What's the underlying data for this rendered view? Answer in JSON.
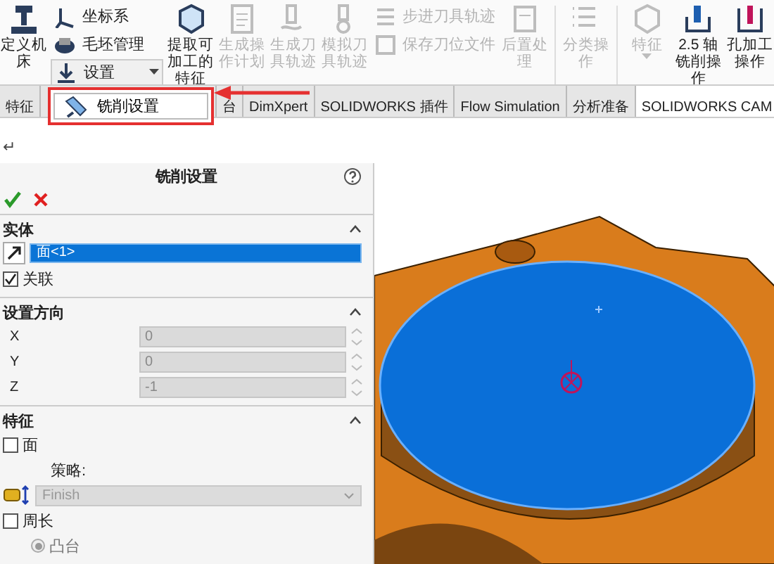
{
  "ribbon": {
    "columns": [
      {
        "kind": "large",
        "label": "定义机床",
        "disabled": false
      },
      {
        "kind": "stack",
        "items": [
          {
            "label": "坐标系",
            "disabled": false,
            "dropdown": false
          },
          {
            "label": "毛坯管理",
            "disabled": false,
            "dropdown": false
          },
          {
            "label": "设置",
            "disabled": false,
            "dropdown": true
          }
        ]
      },
      {
        "kind": "large",
        "label": "提取可加工的特征",
        "disabled": false
      },
      {
        "kind": "large",
        "label": "生成操作计划",
        "disabled": true
      },
      {
        "kind": "large",
        "label": "生成刀具轨迹",
        "disabled": true
      },
      {
        "kind": "large",
        "label": "模拟刀具轨迹",
        "disabled": true
      },
      {
        "kind": "stack",
        "items": [
          {
            "label": "步进刀具轨迹",
            "disabled": true,
            "dropdown": false
          },
          {
            "label": "保存刀位文件",
            "disabled": true,
            "dropdown": false
          }
        ]
      },
      {
        "kind": "large",
        "label": "后置处理",
        "disabled": true
      },
      {
        "kind": "separator"
      },
      {
        "kind": "large",
        "label": "分类操作",
        "disabled": true
      },
      {
        "kind": "separator"
      },
      {
        "kind": "large",
        "label": "特征",
        "disabled": true,
        "dropdown": true
      },
      {
        "kind": "large",
        "label": "2.5 轴铣削操作",
        "disabled": false
      },
      {
        "kind": "large",
        "label": "孔加工操作",
        "disabled": false
      }
    ]
  },
  "tabs": [
    {
      "label": "特征",
      "selected": false
    },
    {
      "label": "台",
      "selected": false
    },
    {
      "label": "DimXpert",
      "selected": false
    },
    {
      "label": "SOLIDWORKS 插件",
      "selected": false
    },
    {
      "label": "Flow Simulation",
      "selected": false
    },
    {
      "label": "分析准备",
      "selected": false
    },
    {
      "label": "SOLIDWORKS CAM",
      "selected": true
    }
  ],
  "dropdown_menu": {
    "items": [
      {
        "label": "铣削设置"
      }
    ]
  },
  "return_mark": "↵",
  "panel": {
    "title": "铣削设置",
    "sections": [
      {
        "title": "实体",
        "expanded": true,
        "rows": [
          {
            "kind": "selection",
            "value": "面<1>"
          },
          {
            "kind": "checkbox",
            "label": "关联",
            "checked": true
          }
        ]
      },
      {
        "title": "设置方向",
        "expanded": true,
        "rows": [
          {
            "kind": "number",
            "label": "X",
            "value": "0",
            "disabled": true
          },
          {
            "kind": "number",
            "label": "Y",
            "value": "0",
            "disabled": true
          },
          {
            "kind": "number",
            "label": "Z",
            "value": "-1",
            "disabled": true
          }
        ]
      },
      {
        "title": "特征",
        "expanded": true,
        "rows": [
          {
            "kind": "checkbox",
            "label": "面",
            "checked": false
          },
          {
            "kind": "label",
            "label": "策略:"
          },
          {
            "kind": "dropdown",
            "value": "Finish",
            "disabled": true
          },
          {
            "kind": "checkbox",
            "label": "周长",
            "checked": false
          },
          {
            "kind": "radio",
            "label": "凸台",
            "selected": true,
            "disabled": true
          }
        ]
      }
    ]
  }
}
